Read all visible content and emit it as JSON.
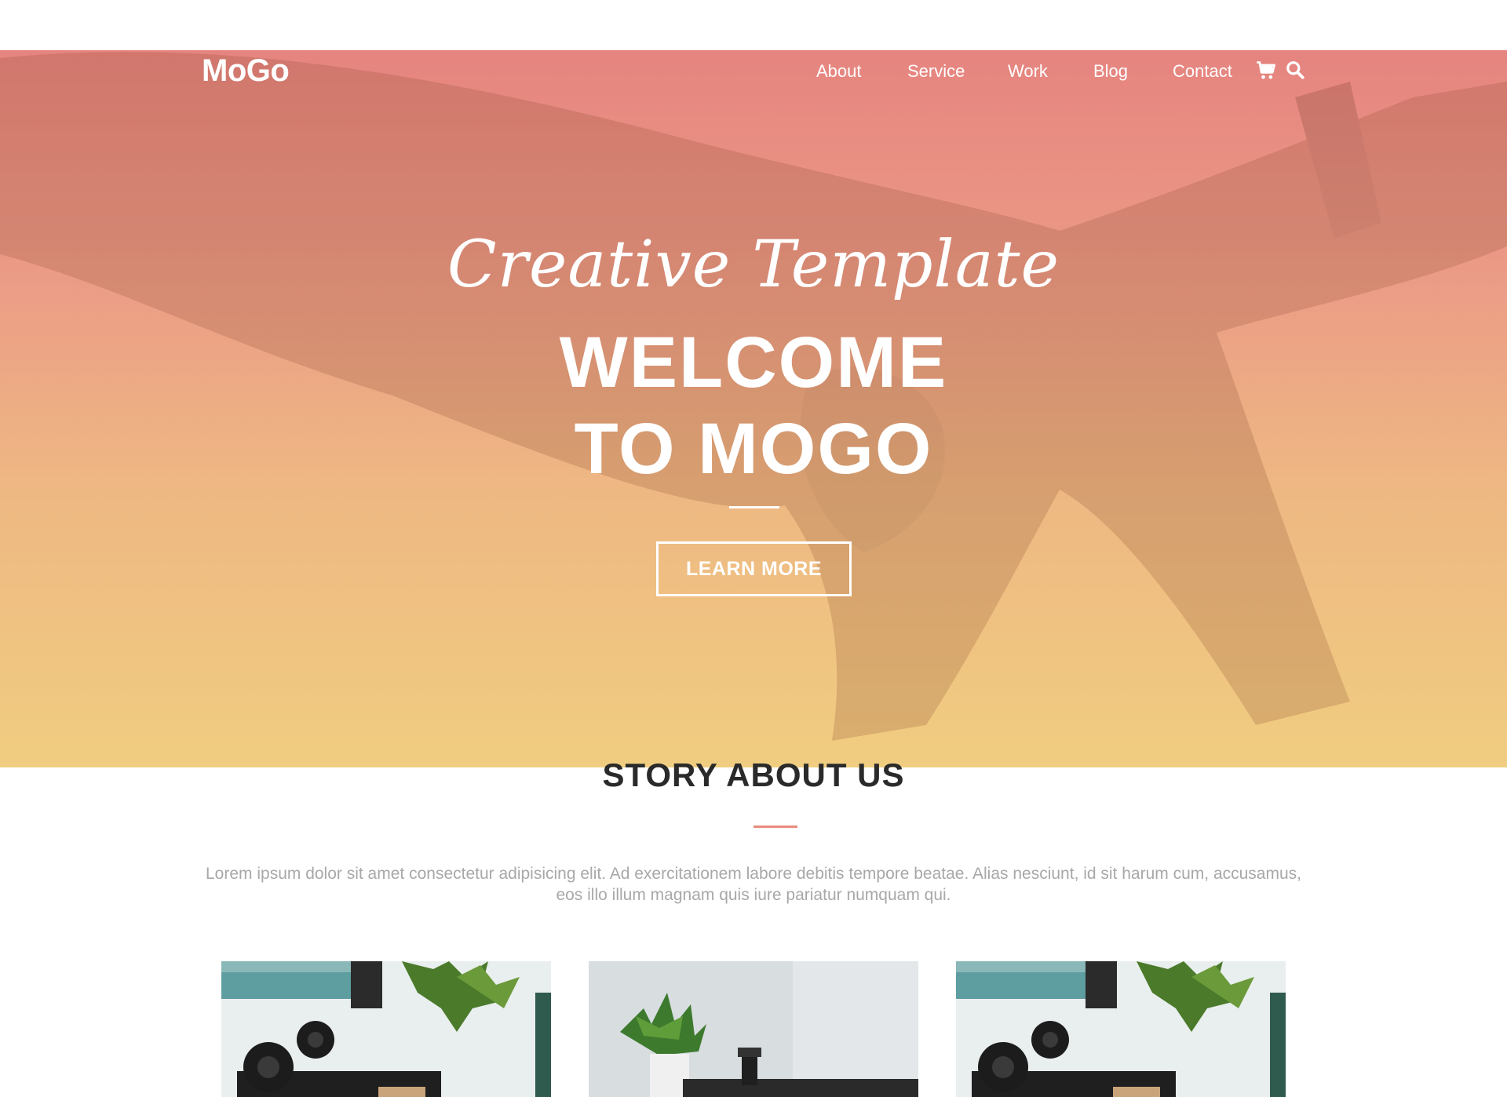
{
  "nav": {
    "logo": "MoGo",
    "links": [
      "About",
      "Service",
      "Work",
      "Blog",
      "Contact"
    ],
    "cart_icon": "cart-icon",
    "search_icon": "search-icon"
  },
  "hero": {
    "script_title": "Creative Template",
    "title_line1": "WELCOME",
    "title_line2": "TO MOGO",
    "button_label": "LEARN MORE",
    "gradient_top": "#e6847f",
    "gradient_bottom": "#f0cd80"
  },
  "story": {
    "title": "STORY ABOUT US",
    "text": "Lorem ipsum dolor sit amet consectetur adipisicing elit. Ad exercitationem labore debitis tempore beatae. Alias nesciunt, id sit harum cum, accusamus, eos illo illum magnam quis iure pariatur numquam qui.",
    "accent_color": "#e88c7e"
  },
  "cards": [
    {
      "name": "desk-photo-1"
    },
    {
      "name": "desk-photo-2"
    },
    {
      "name": "desk-photo-3"
    }
  ]
}
